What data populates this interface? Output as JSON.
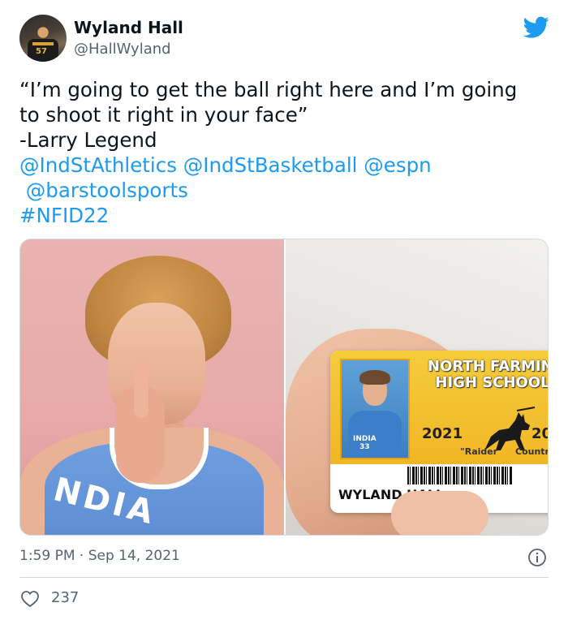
{
  "author": {
    "name": "Wyland Hall",
    "handle": "@HallWyland",
    "avatar_jersey_number": "57"
  },
  "brand": {
    "logo_icon": "twitter-bird-icon",
    "accent_color": "#1d9bf0"
  },
  "tweet": {
    "quote_line1": "“I’m going to get the ball right here and I’m going",
    "quote_line2": "to shoot it right in your face”",
    "attribution": "-Larry Legend",
    "mentions": [
      "@IndStAthletics",
      "@IndStBasketball",
      "@espn",
      "@barstoolsports"
    ],
    "hashtag": "#NFID22"
  },
  "media": {
    "left_photo_jersey_text": "NDIA",
    "id_card": {
      "school_line1": "NORTH FARMINGT",
      "school_line2": "HIGH SCHOOL",
      "year": "2021",
      "year_cut": "20",
      "mascot_left": "\"Raider",
      "mascot_right": "Countr",
      "photo_jersey": "INDIA\n33",
      "student_name": "WYLAND HALL"
    }
  },
  "footer": {
    "time": "1:59 PM",
    "separator": "·",
    "date": "Sep 14, 2021",
    "likes": "237",
    "info_icon": "info-icon",
    "like_icon": "heart-icon"
  }
}
